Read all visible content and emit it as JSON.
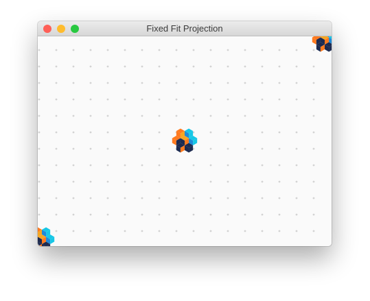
{
  "window": {
    "title": "Fixed Fit Projection"
  },
  "colors": {
    "close": "#fe5f57",
    "minimize": "#febc2e",
    "zoom": "#28c840",
    "grid_dot": "#d3d3d3",
    "canvas_bg": "#fafafa",
    "cube_orange": "#ff7a1f",
    "cube_cyan": "#17c7e6",
    "cube_navy": "#1d2a4f",
    "cube_yellow": "#f5a623",
    "cube_blue": "#1f8ad8"
  },
  "icons": {
    "close": "close-icon",
    "minimize": "minimize-icon",
    "zoom": "zoom-icon",
    "cluster": "isometric-cube-cluster-icon"
  }
}
